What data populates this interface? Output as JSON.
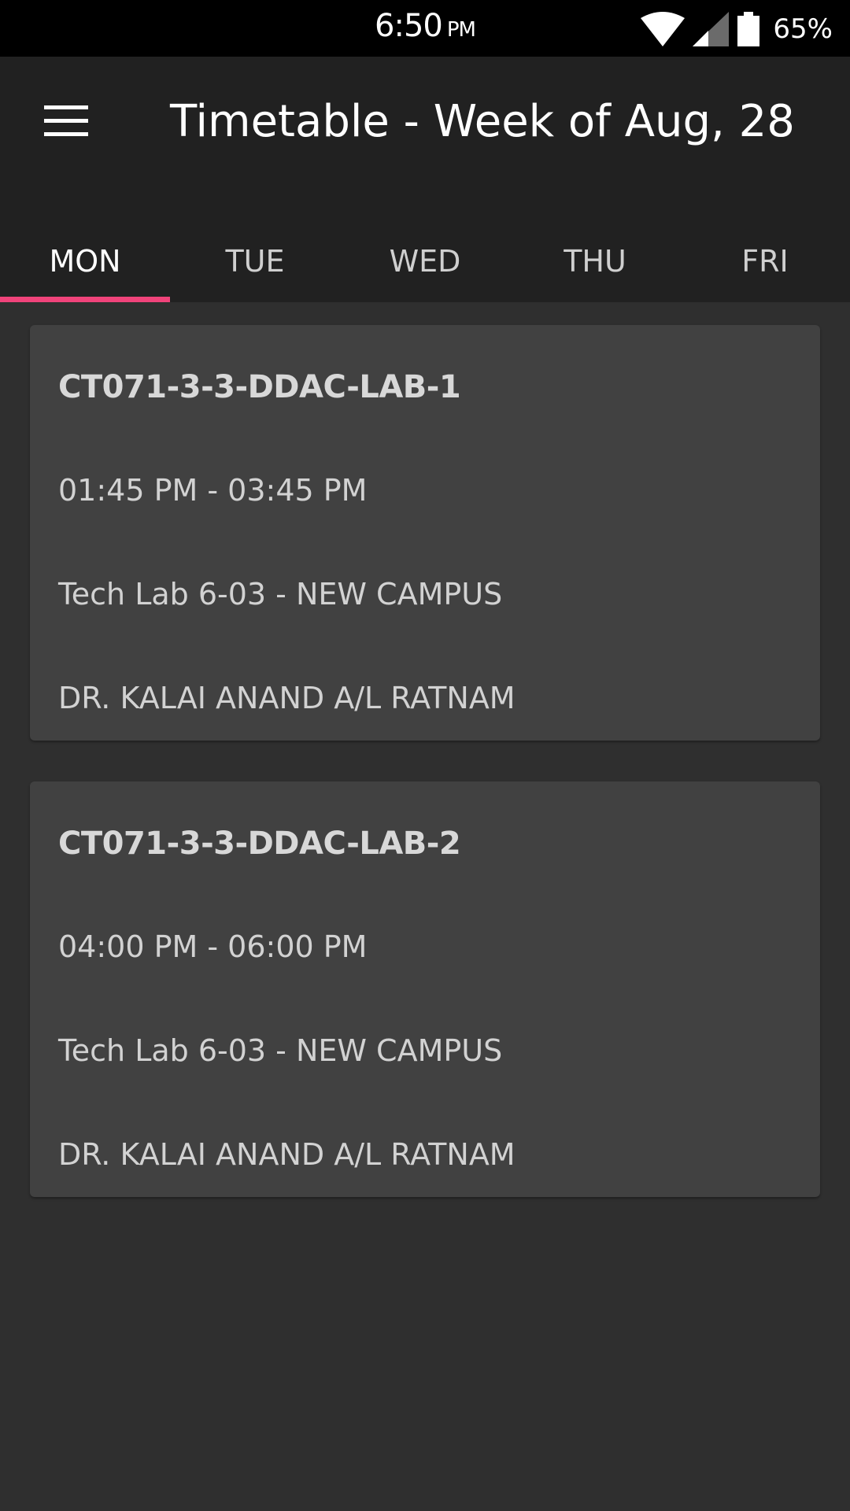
{
  "status_bar": {
    "time": "6:50",
    "ampm": "PM",
    "battery_percent": "65%",
    "icons": [
      "wifi-icon",
      "cellular-signal-icon",
      "battery-icon"
    ]
  },
  "app_bar": {
    "menu_icon": "hamburger-menu-icon",
    "title": "Timetable - Week of Aug, 28",
    "background": "#212121"
  },
  "tabs": [
    {
      "label": "MON",
      "active": true
    },
    {
      "label": "TUE",
      "active": false
    },
    {
      "label": "WED",
      "active": false
    },
    {
      "label": "THU",
      "active": false
    },
    {
      "label": "FRI",
      "active": false
    }
  ],
  "accent_color": "#f0437a",
  "classes": [
    {
      "code": "CT071-3-3-DDAC-LAB-1",
      "time": "01:45 PM - 03:45 PM",
      "room": "Tech Lab 6-03 - NEW CAMPUS",
      "lecturer": "DR. KALAI ANAND A/L RATNAM"
    },
    {
      "code": "CT071-3-3-DDAC-LAB-2",
      "time": "04:00 PM - 06:00 PM",
      "room": "Tech Lab 6-03 - NEW CAMPUS",
      "lecturer": "DR. KALAI ANAND A/L RATNAM"
    }
  ]
}
